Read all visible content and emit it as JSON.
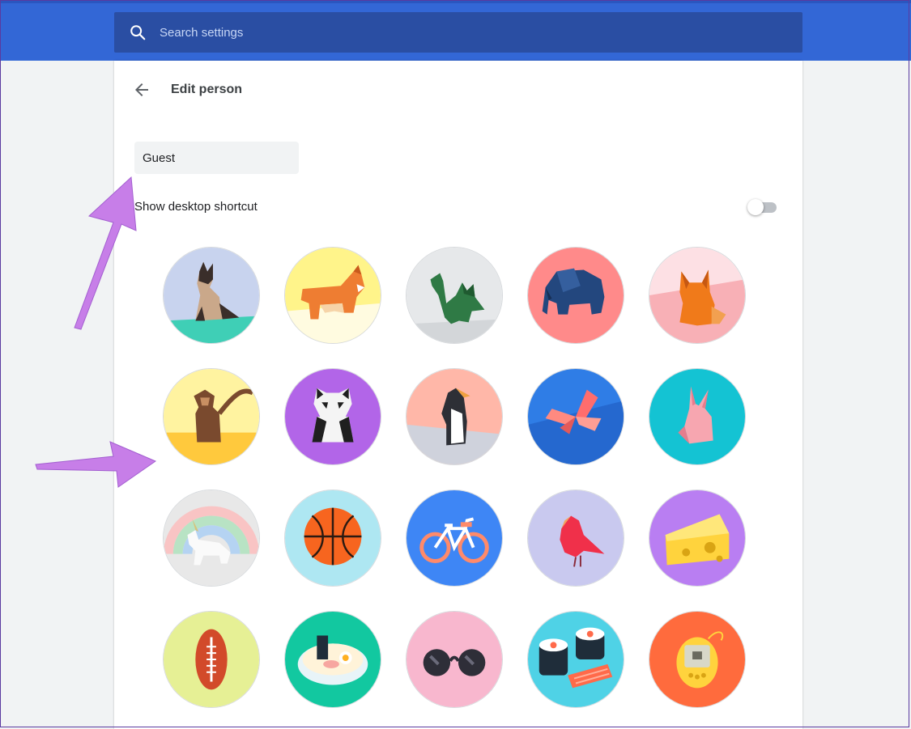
{
  "search": {
    "placeholder": "Search settings",
    "icon": "search-icon"
  },
  "header": {
    "title": "Edit person",
    "back_icon": "arrow-back-icon"
  },
  "name_field": {
    "value": "Guest"
  },
  "desktop_shortcut": {
    "label": "Show desktop shortcut",
    "enabled": false
  },
  "avatars": [
    {
      "name": "cat",
      "bg": "#c8d3ee"
    },
    {
      "name": "corgi",
      "bg": "#fff48a"
    },
    {
      "name": "dragon",
      "bg": "#e6e8ea"
    },
    {
      "name": "elephant",
      "bg": "#ff8a8a"
    },
    {
      "name": "fox",
      "bg": "#fde0e4"
    },
    {
      "name": "monkey",
      "bg": "#fff3a0"
    },
    {
      "name": "panda",
      "bg": "#b265e8"
    },
    {
      "name": "penguin",
      "bg": "#ffb7a8"
    },
    {
      "name": "butterfly",
      "bg": "#2f7de6"
    },
    {
      "name": "rabbit",
      "bg": "#14c3d3"
    },
    {
      "name": "unicorn",
      "bg": "#e8e8e8"
    },
    {
      "name": "basketball",
      "bg": "#aee7f2"
    },
    {
      "name": "bike",
      "bg": "#3e86f5"
    },
    {
      "name": "bird",
      "bg": "#c9c9ef"
    },
    {
      "name": "cheese",
      "bg": "#b97ef2"
    },
    {
      "name": "football",
      "bg": "#e6f095"
    },
    {
      "name": "noodles",
      "bg": "#12c8a0"
    },
    {
      "name": "sunglasses",
      "bg": "#f8b7ce"
    },
    {
      "name": "sushi",
      "bg": "#4fd2e6"
    },
    {
      "name": "tamagotchi",
      "bg": "#ff6b3d"
    }
  ],
  "colors": {
    "topbar": "#3367d6",
    "search": "#2a4ea3",
    "annotation_arrow": "#c77ee8"
  }
}
